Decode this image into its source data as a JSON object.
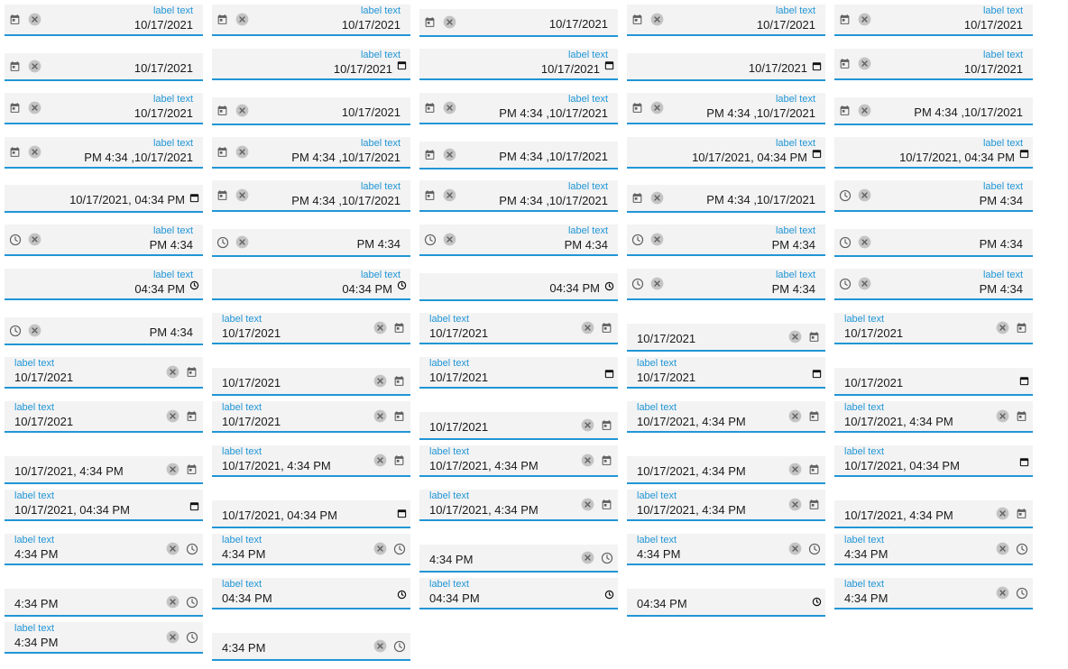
{
  "fields": [
    {
      "label": "label text",
      "value": "10/17/2021",
      "icons": [
        "calendar",
        "clear"
      ],
      "align": "right"
    },
    {
      "label": "label text",
      "value": "10/17/2021",
      "icons": [
        "calendar",
        "clear"
      ],
      "align": "right"
    },
    {
      "label": "",
      "value": "10/17/2021",
      "icons": [
        "calendar",
        "clear"
      ],
      "align": "right"
    },
    {
      "label": "label text",
      "value": "10/17/2021",
      "icons": [
        "calendar",
        "clear"
      ],
      "align": "right"
    },
    {
      "label": "label text",
      "value": "10/17/2021",
      "icons": [
        "calendar",
        "clear"
      ],
      "align": "right"
    },
    {
      "label": "",
      "value": "10/17/2021",
      "icons": [
        "calendar",
        "clear"
      ],
      "align": "right"
    },
    {
      "label": "label text",
      "value": "10/17/2021",
      "icons": [],
      "picker": "calendar",
      "align": "right"
    },
    {
      "label": "label text",
      "value": "10/17/2021",
      "icons": [],
      "picker": "calendar",
      "align": "right"
    },
    {
      "label": "",
      "value": "10/17/2021",
      "icons": [],
      "picker": "calendar",
      "align": "right"
    },
    {
      "label": "label text",
      "value": "10/17/2021",
      "icons": [
        "calendar",
        "clear"
      ],
      "align": "right"
    },
    {
      "label": "label text",
      "value": "10/17/2021",
      "icons": [
        "calendar",
        "clear"
      ],
      "align": "right"
    },
    {
      "label": "",
      "value": "10/17/2021",
      "icons": [
        "calendar",
        "clear"
      ],
      "align": "right"
    },
    {
      "label": "label text",
      "value": "PM 4:34 ,10/17/2021",
      "icons": [
        "calendar",
        "clear"
      ],
      "align": "right"
    },
    {
      "label": "label text",
      "value": "PM 4:34 ,10/17/2021",
      "icons": [
        "calendar",
        "clear"
      ],
      "align": "right"
    },
    {
      "label": "",
      "value": "PM 4:34 ,10/17/2021",
      "icons": [
        "calendar",
        "clear"
      ],
      "align": "right"
    },
    {
      "label": "label text",
      "value": "PM 4:34 ,10/17/2021",
      "icons": [
        "calendar",
        "clear"
      ],
      "align": "right"
    },
    {
      "label": "label text",
      "value": "PM 4:34 ,10/17/2021",
      "icons": [
        "calendar",
        "clear"
      ],
      "align": "right"
    },
    {
      "label": "",
      "value": "PM 4:34 ,10/17/2021",
      "icons": [
        "calendar",
        "clear"
      ],
      "align": "right"
    },
    {
      "label": "label text",
      "value": "10/17/2021, 04:34 PM",
      "icons": [],
      "picker": "calendar",
      "align": "right"
    },
    {
      "label": "label text",
      "value": "10/17/2021, 04:34 PM",
      "icons": [],
      "picker": "calendar",
      "align": "right"
    },
    {
      "label": "",
      "value": "10/17/2021, 04:34 PM",
      "icons": [],
      "picker": "calendar",
      "align": "right"
    },
    {
      "label": "label text",
      "value": "PM 4:34 ,10/17/2021",
      "icons": [
        "calendar",
        "clear"
      ],
      "align": "right"
    },
    {
      "label": "label text",
      "value": "PM 4:34 ,10/17/2021",
      "icons": [
        "calendar",
        "clear"
      ],
      "align": "right"
    },
    {
      "label": "",
      "value": "PM 4:34 ,10/17/2021",
      "icons": [
        "calendar",
        "clear"
      ],
      "align": "right"
    },
    {
      "label": "label text",
      "value": "PM 4:34",
      "icons": [
        "clock",
        "clear"
      ],
      "align": "right"
    },
    {
      "label": "label text",
      "value": "PM 4:34",
      "icons": [
        "clock",
        "clear"
      ],
      "align": "right"
    },
    {
      "label": "",
      "value": "PM 4:34",
      "icons": [
        "clock",
        "clear"
      ],
      "align": "right"
    },
    {
      "label": "label text",
      "value": "PM 4:34",
      "icons": [
        "clock",
        "clear"
      ],
      "align": "right"
    },
    {
      "label": "label text",
      "value": "PM 4:34",
      "icons": [
        "clock",
        "clear"
      ],
      "align": "right"
    },
    {
      "label": "",
      "value": "PM 4:34",
      "icons": [
        "clock",
        "clear"
      ],
      "align": "right"
    },
    {
      "label": "label text",
      "value": "04:34 PM",
      "icons": [],
      "picker": "clock",
      "align": "right"
    },
    {
      "label": "label text",
      "value": "04:34 PM",
      "icons": [],
      "picker": "clock",
      "align": "right"
    },
    {
      "label": "",
      "value": "04:34 PM",
      "icons": [],
      "picker": "clock",
      "align": "right"
    },
    {
      "label": "label text",
      "value": "PM 4:34",
      "icons": [
        "clock",
        "clear"
      ],
      "align": "right"
    },
    {
      "label": "label text",
      "value": "PM 4:34",
      "icons": [
        "clock",
        "clear"
      ],
      "align": "right"
    },
    {
      "label": "",
      "value": "PM 4:34",
      "icons": [
        "clock",
        "clear"
      ],
      "align": "right"
    },
    {
      "label": "label text",
      "value": "10/17/2021",
      "icons": [
        "clear",
        "calendar"
      ],
      "align": "left"
    },
    {
      "label": "label text",
      "value": "10/17/2021",
      "icons": [
        "clear",
        "calendar"
      ],
      "align": "left"
    },
    {
      "label": "",
      "value": "10/17/2021",
      "icons": [
        "clear",
        "calendar"
      ],
      "align": "left"
    },
    {
      "label": "label text",
      "value": "10/17/2021",
      "icons": [
        "clear",
        "calendar"
      ],
      "align": "left"
    },
    {
      "label": "label text",
      "value": "10/17/2021",
      "icons": [
        "clear",
        "calendar"
      ],
      "align": "left"
    },
    {
      "label": "",
      "value": "10/17/2021",
      "icons": [
        "clear",
        "calendar"
      ],
      "align": "left"
    },
    {
      "label": "label text",
      "value": "10/17/2021",
      "icons": [],
      "picker": "calendar",
      "align": "left"
    },
    {
      "label": "label text",
      "value": "10/17/2021",
      "icons": [],
      "picker": "calendar",
      "align": "left"
    },
    {
      "label": "",
      "value": "10/17/2021",
      "icons": [],
      "picker": "calendar",
      "align": "left"
    },
    {
      "label": "label text",
      "value": "10/17/2021",
      "icons": [
        "clear",
        "calendar"
      ],
      "align": "left"
    },
    {
      "label": "label text",
      "value": "10/17/2021",
      "icons": [
        "clear",
        "calendar"
      ],
      "align": "left"
    },
    {
      "label": "",
      "value": "10/17/2021",
      "icons": [
        "clear",
        "calendar"
      ],
      "align": "left"
    },
    {
      "label": "label text",
      "value": "10/17/2021, 4:34 PM",
      "icons": [
        "clear",
        "calendar"
      ],
      "align": "left"
    },
    {
      "label": "label text",
      "value": "10/17/2021, 4:34 PM",
      "icons": [
        "clear",
        "calendar"
      ],
      "align": "left"
    },
    {
      "label": "",
      "value": "10/17/2021, 4:34 PM",
      "icons": [
        "clear",
        "calendar"
      ],
      "align": "left"
    },
    {
      "label": "label text",
      "value": "10/17/2021, 4:34 PM",
      "icons": [
        "clear",
        "calendar"
      ],
      "align": "left"
    },
    {
      "label": "label text",
      "value": "10/17/2021, 4:34 PM",
      "icons": [
        "clear",
        "calendar"
      ],
      "align": "left"
    },
    {
      "label": "",
      "value": "10/17/2021, 4:34 PM",
      "icons": [
        "clear",
        "calendar"
      ],
      "align": "left"
    },
    {
      "label": "label text",
      "value": "10/17/2021, 04:34 PM",
      "icons": [],
      "picker": "calendar",
      "align": "left"
    },
    {
      "label": "label text",
      "value": "10/17/2021, 04:34 PM",
      "icons": [],
      "picker": "calendar",
      "align": "left"
    },
    {
      "label": "",
      "value": "10/17/2021, 04:34 PM",
      "icons": [],
      "picker": "calendar",
      "align": "left"
    },
    {
      "label": "label text",
      "value": "10/17/2021, 4:34 PM",
      "icons": [
        "clear",
        "calendar"
      ],
      "align": "left"
    },
    {
      "label": "label text",
      "value": "10/17/2021, 4:34 PM",
      "icons": [
        "clear",
        "calendar"
      ],
      "align": "left"
    },
    {
      "label": "",
      "value": "10/17/2021, 4:34 PM",
      "icons": [
        "clear",
        "calendar"
      ],
      "align": "left"
    },
    {
      "label": "label text",
      "value": "4:34 PM",
      "icons": [
        "clear",
        "clock"
      ],
      "align": "left"
    },
    {
      "label": "label text",
      "value": "4:34 PM",
      "icons": [
        "clear",
        "clock"
      ],
      "align": "left"
    },
    {
      "label": "",
      "value": "4:34 PM",
      "icons": [
        "clear",
        "clock"
      ],
      "align": "left"
    },
    {
      "label": "label text",
      "value": "4:34 PM",
      "icons": [
        "clear",
        "clock"
      ],
      "align": "left"
    },
    {
      "label": "label text",
      "value": "4:34 PM",
      "icons": [
        "clear",
        "clock"
      ],
      "align": "left"
    },
    {
      "label": "",
      "value": "4:34 PM",
      "icons": [
        "clear",
        "clock"
      ],
      "align": "left"
    },
    {
      "label": "label text",
      "value": "04:34 PM",
      "icons": [],
      "picker": "clock",
      "align": "left"
    },
    {
      "label": "label text",
      "value": "04:34 PM",
      "icons": [],
      "picker": "clock",
      "align": "left"
    },
    {
      "label": "",
      "value": "04:34 PM",
      "icons": [],
      "picker": "clock",
      "align": "left"
    },
    {
      "label": "label text",
      "value": "4:34 PM",
      "icons": [
        "clear",
        "clock"
      ],
      "align": "left"
    },
    {
      "label": "label text",
      "value": "4:34 PM",
      "icons": [
        "clear",
        "clock"
      ],
      "align": "left"
    },
    {
      "label": "",
      "value": "4:34 PM",
      "icons": [
        "clear",
        "clock"
      ],
      "align": "left"
    }
  ],
  "colors": {
    "accent": "#2196d6",
    "field_bg": "#f3f3f3",
    "icon": "#5f5f5f",
    "clear_bg": "#c4c4c4"
  }
}
